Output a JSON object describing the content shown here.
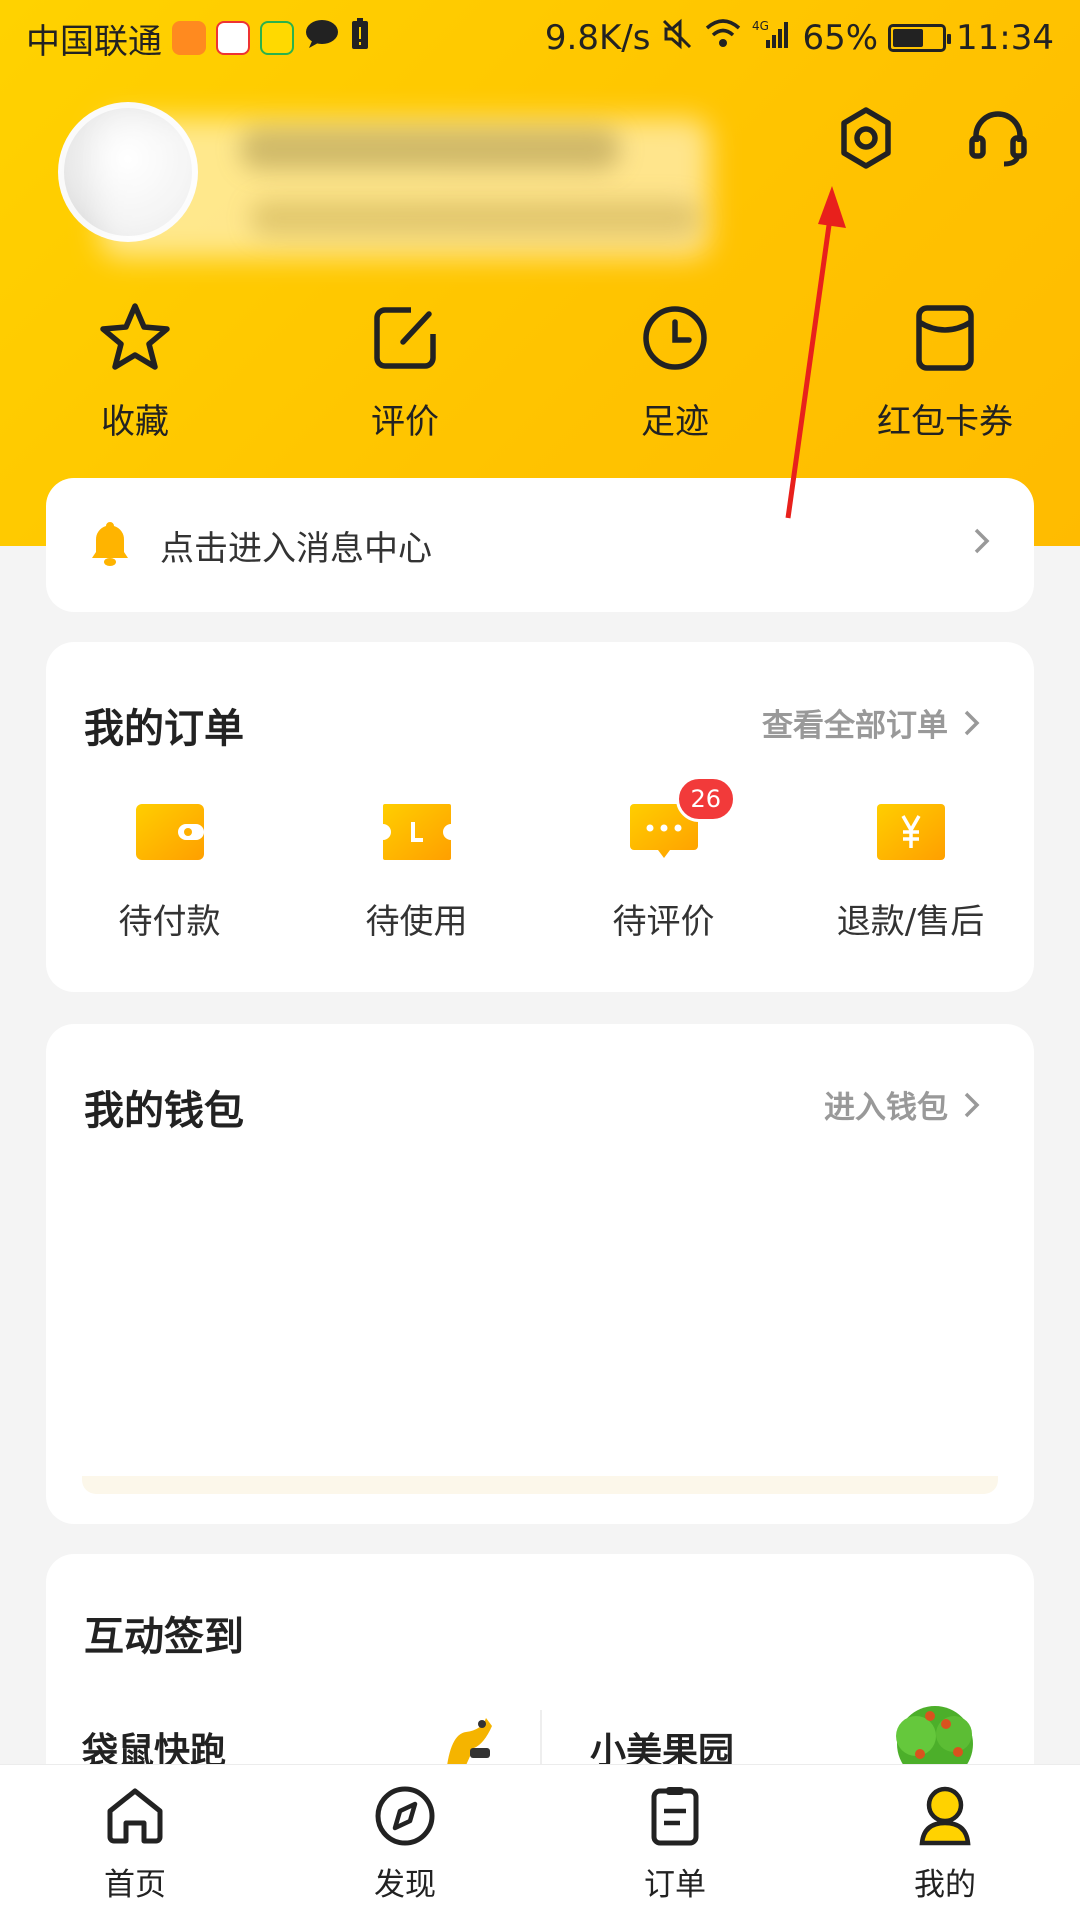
{
  "status_bar": {
    "carrier": "中国联通",
    "speed": "9.8K/s",
    "network": "4G",
    "battery": "65%",
    "time": "11:34",
    "battery_level": 0.65
  },
  "header": {
    "settings_icon": "gear-icon",
    "service_icon": "headset-icon"
  },
  "quick_actions": [
    {
      "label": "收藏",
      "icon": "star-icon"
    },
    {
      "label": "评价",
      "icon": "edit-icon"
    },
    {
      "label": "足迹",
      "icon": "clock-icon"
    },
    {
      "label": "红包卡券",
      "icon": "coupon-icon"
    }
  ],
  "message_center": {
    "text": "点击进入消息中心",
    "icon": "bell-icon"
  },
  "orders": {
    "title": "我的订单",
    "link": "查看全部订单",
    "items": [
      {
        "label": "待付款",
        "icon": "wallet-icon"
      },
      {
        "label": "待使用",
        "icon": "ticket-icon"
      },
      {
        "label": "待评价",
        "icon": "comment-icon",
        "badge": "26"
      },
      {
        "label": "退款/售后",
        "icon": "yen-icon"
      }
    ]
  },
  "wallet": {
    "title": "我的钱包",
    "link": "进入钱包"
  },
  "sign_in": {
    "title": "互动签到",
    "items": [
      {
        "name": "袋鼠快跑"
      },
      {
        "name": "小美果园"
      }
    ]
  },
  "tabbar": {
    "tabs": [
      {
        "label": "首页",
        "icon": "home-icon"
      },
      {
        "label": "发现",
        "icon": "compass-icon"
      },
      {
        "label": "订单",
        "icon": "order-list-icon"
      },
      {
        "label": "我的",
        "icon": "profile-icon"
      }
    ]
  },
  "colors": {
    "brand_yellow": "#ffc300",
    "badge_red": "#f23a3a",
    "annotation_red": "#e8201c"
  }
}
